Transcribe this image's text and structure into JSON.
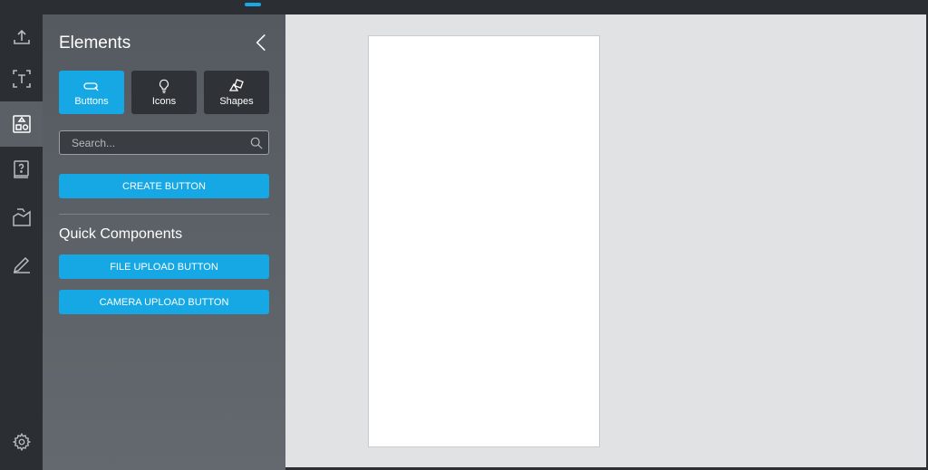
{
  "panel": {
    "title": "Elements",
    "tabs": [
      {
        "label": "Buttons",
        "icon": "link-button-icon",
        "active": true
      },
      {
        "label": "Icons",
        "icon": "lightbulb-icon",
        "active": false
      },
      {
        "label": "Shapes",
        "icon": "shapes-icon",
        "active": false
      }
    ],
    "search": {
      "placeholder": "Search...",
      "value": ""
    },
    "create_button_label": "CREATE BUTTON",
    "quick_components": {
      "title": "Quick Components",
      "buttons": [
        "FILE UPLOAD BUTTON",
        "CAMERA UPLOAD BUTTON"
      ]
    }
  },
  "rail": {
    "items": [
      "upload-icon",
      "text-icon",
      "elements-icon",
      "help-book-icon",
      "images-icon",
      "edit-icon"
    ],
    "active_index": 2,
    "footer": "gear-icon"
  },
  "colors": {
    "accent": "#15a8e5",
    "rail_bg": "#2b2e33",
    "panel_bg": "#5a6065",
    "workspace_bg": "#e1e2e4",
    "canvas_bg": "#ffffff"
  }
}
